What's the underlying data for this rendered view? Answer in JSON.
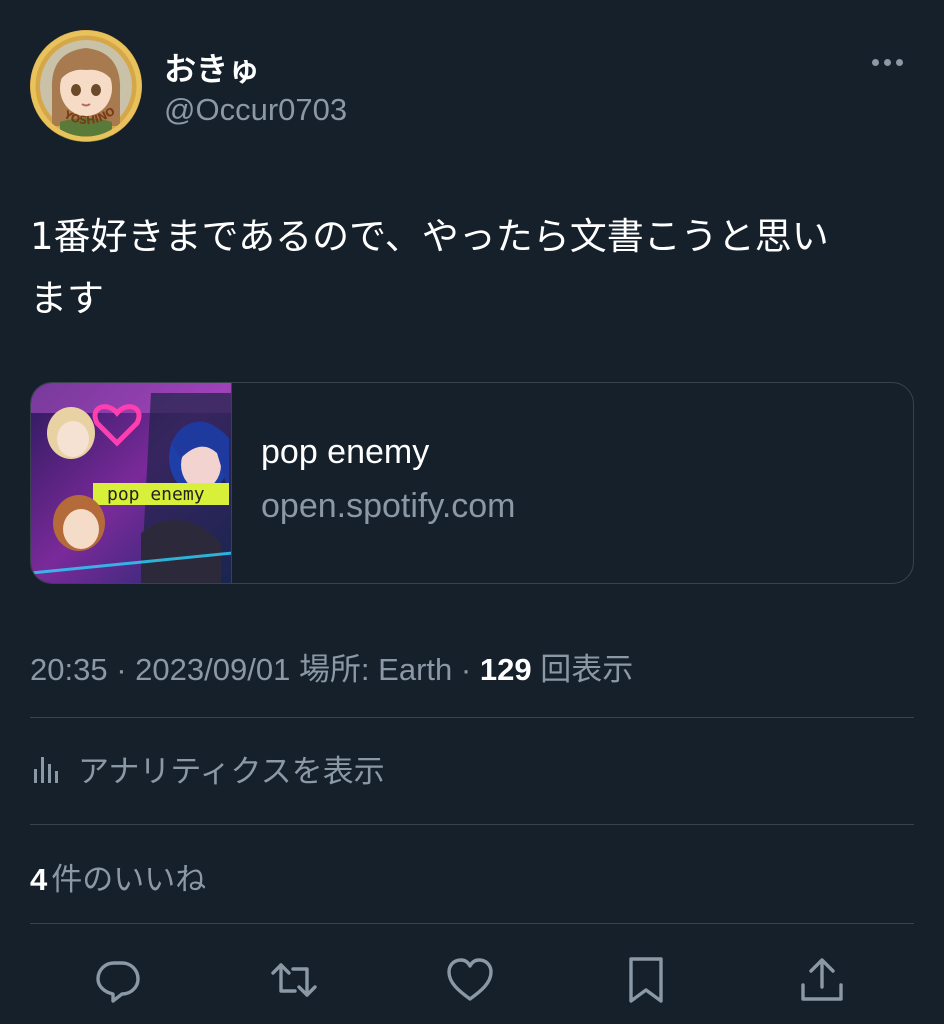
{
  "author": {
    "display_name": "おきゅ",
    "handle": "@Occur0703",
    "avatar_badge_text": "YOSHINO"
  },
  "tweet": {
    "text_line1": "1番好きまであるので、やったら文書こうと思い",
    "text_line2": "ます"
  },
  "card": {
    "title": "pop enemy",
    "domain": "open.spotify.com",
    "thumbnail_text": "pop enemy"
  },
  "meta": {
    "time": "20:35",
    "date": "2023/09/01",
    "location_label": "場所: Earth",
    "views_count": "129",
    "views_label": "回表示",
    "separator": "·"
  },
  "analytics": {
    "label": "アナリティクスを表示"
  },
  "likes": {
    "count": "4",
    "label": "件のいいね"
  },
  "colors": {
    "background": "#15202b",
    "secondary_text": "#8b98a5",
    "border": "#38444d",
    "primary_text": "#ffffff"
  },
  "icons": [
    "more-icon",
    "analytics-icon",
    "reply-icon",
    "retweet-icon",
    "like-icon",
    "bookmark-icon",
    "share-icon"
  ]
}
